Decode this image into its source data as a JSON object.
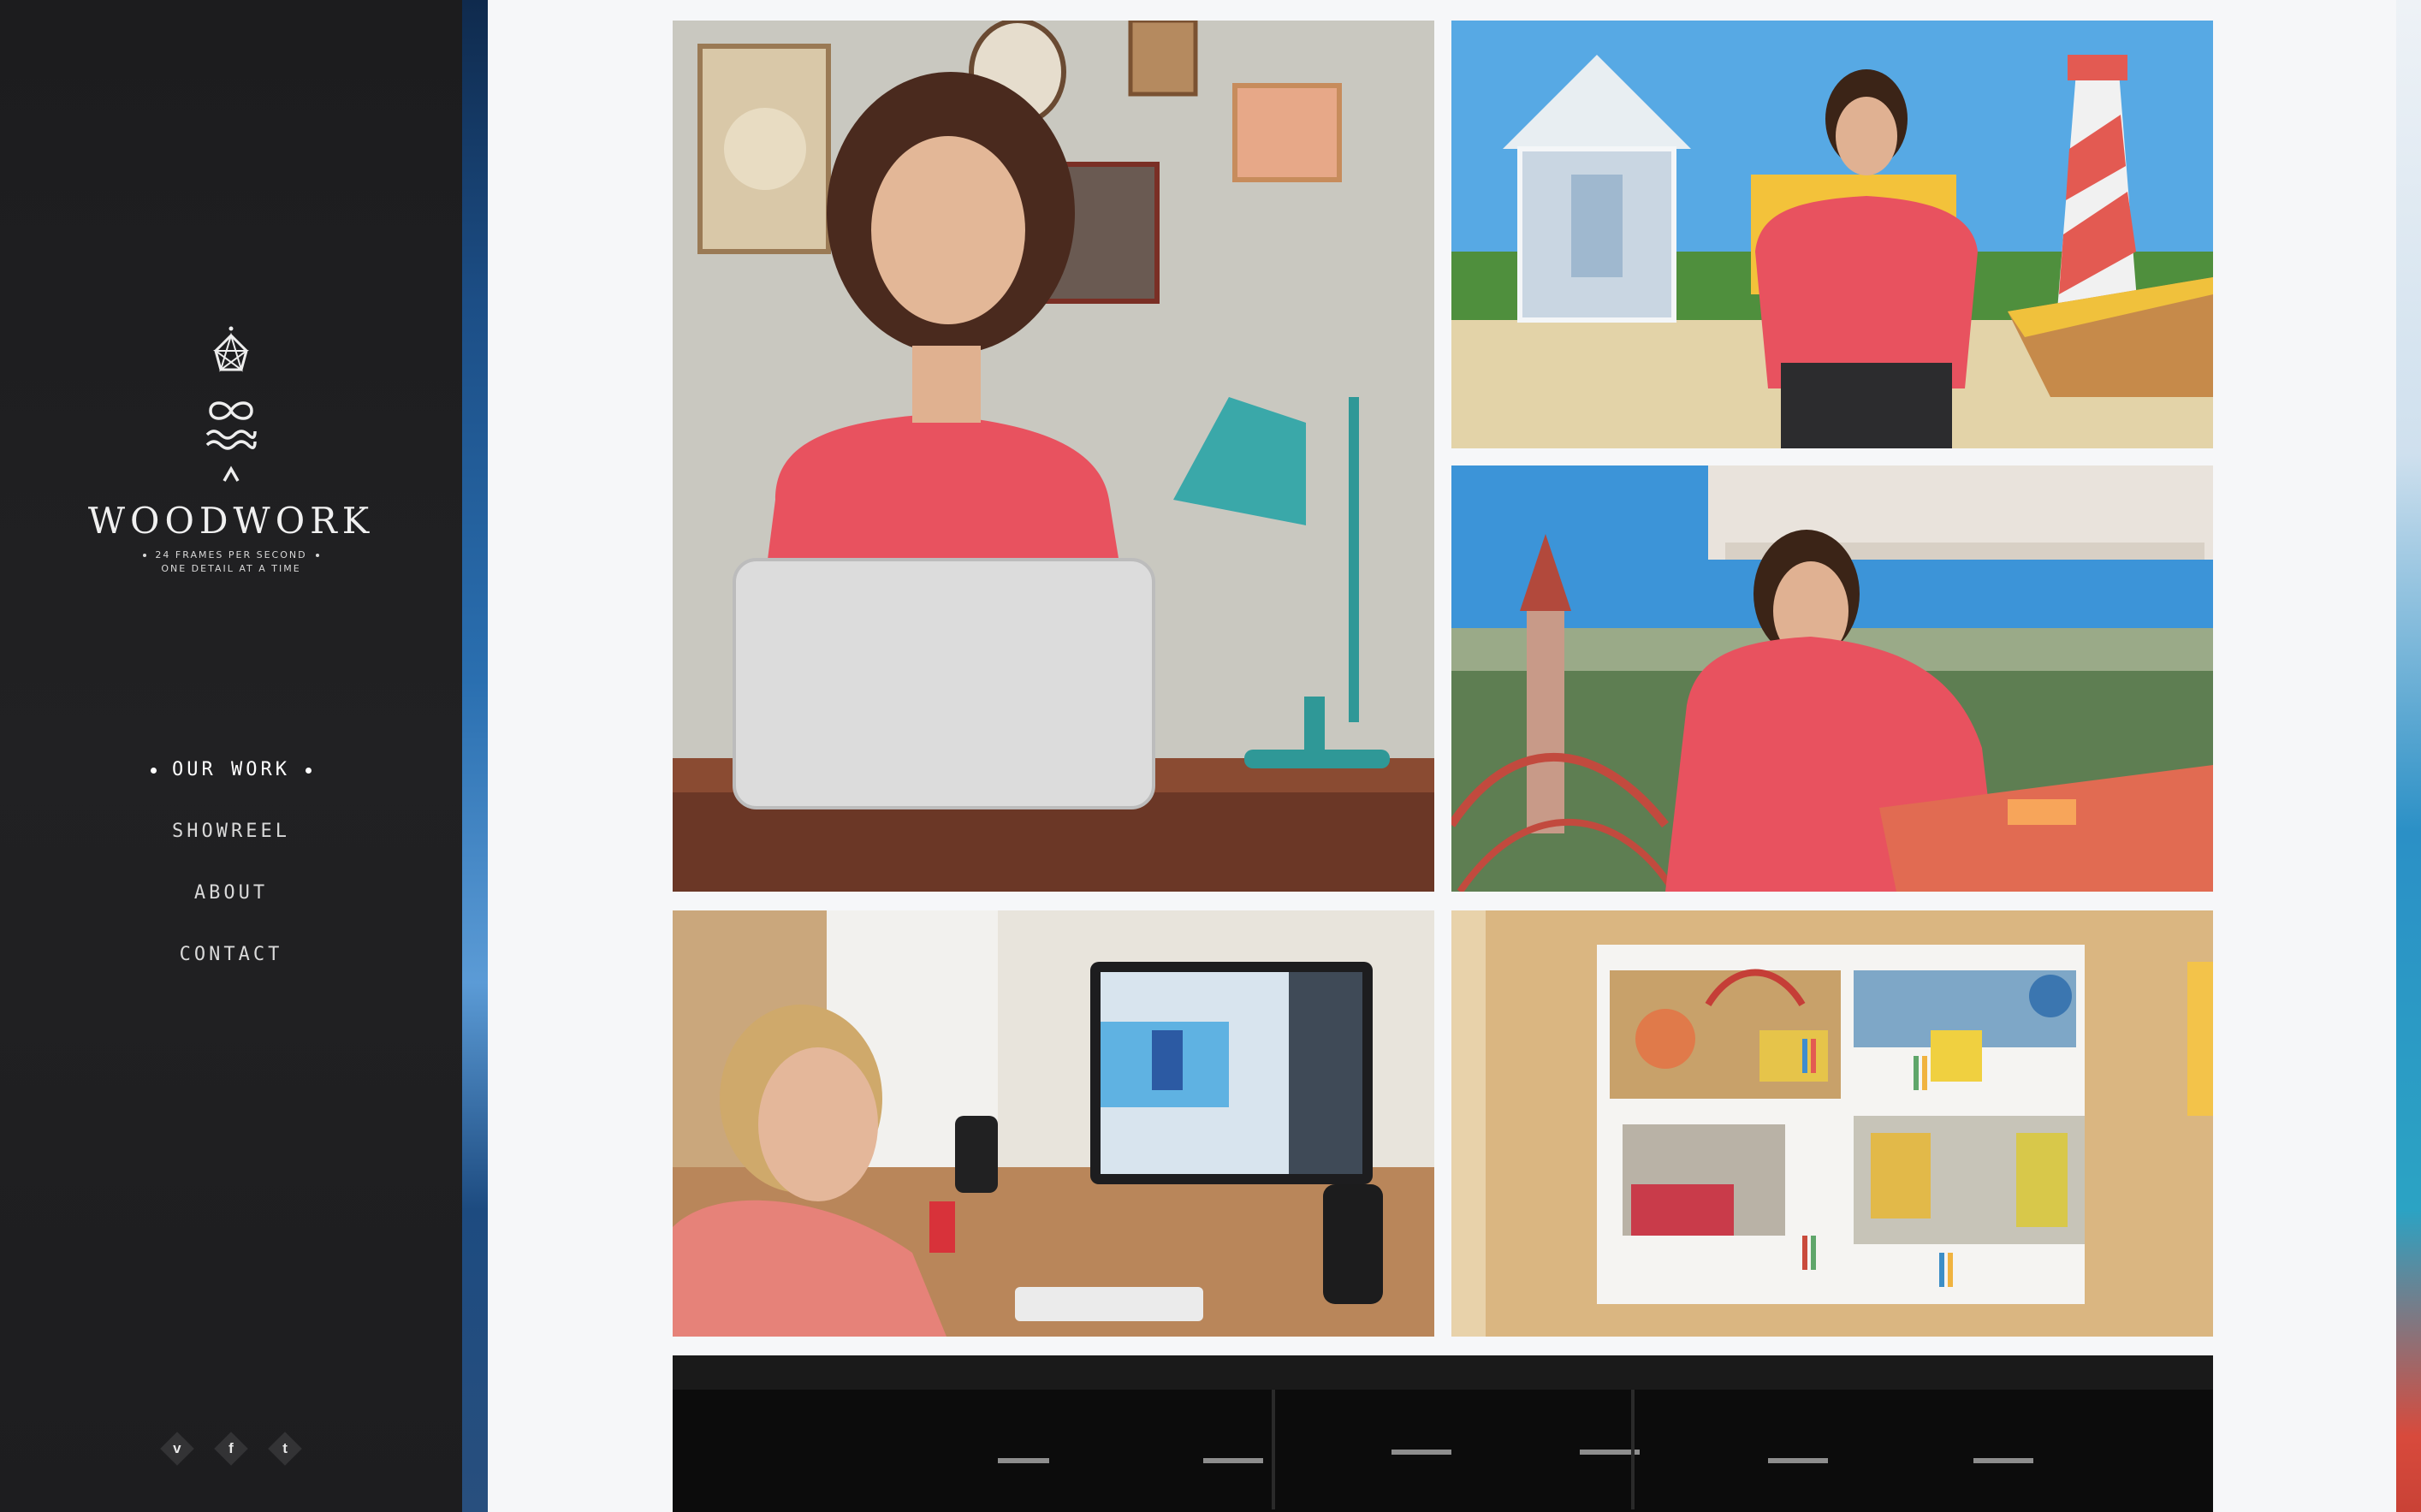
{
  "brand": {
    "name": "WOODWORK",
    "tagline_line1": "24 FRAMES PER SECOND",
    "tagline_line2": "ONE DETAIL AT A TIME"
  },
  "nav": {
    "items": [
      {
        "label": "OUR WORK",
        "active": true
      },
      {
        "label": "SHOWREEL",
        "active": false
      },
      {
        "label": "ABOUT",
        "active": false
      },
      {
        "label": "CONTACT",
        "active": false
      }
    ]
  },
  "social": {
    "vimeo": "v",
    "facebook": "f",
    "tumblr": "t"
  },
  "colors": {
    "sidebar": "#1f1f21",
    "content_bg": "#f6f7f9",
    "shirt_pink": "#e8525f",
    "lamp_teal": "#3aa8a9",
    "sky_blue": "#4fa6df"
  },
  "tiles": [
    {
      "name": "woman-laptop-desk"
    },
    {
      "name": "woman-beach-set"
    },
    {
      "name": "woman-amusement-ride"
    },
    {
      "name": "animator-workstation"
    },
    {
      "name": "moodboard-wall"
    },
    {
      "name": "dark-theatre"
    }
  ]
}
